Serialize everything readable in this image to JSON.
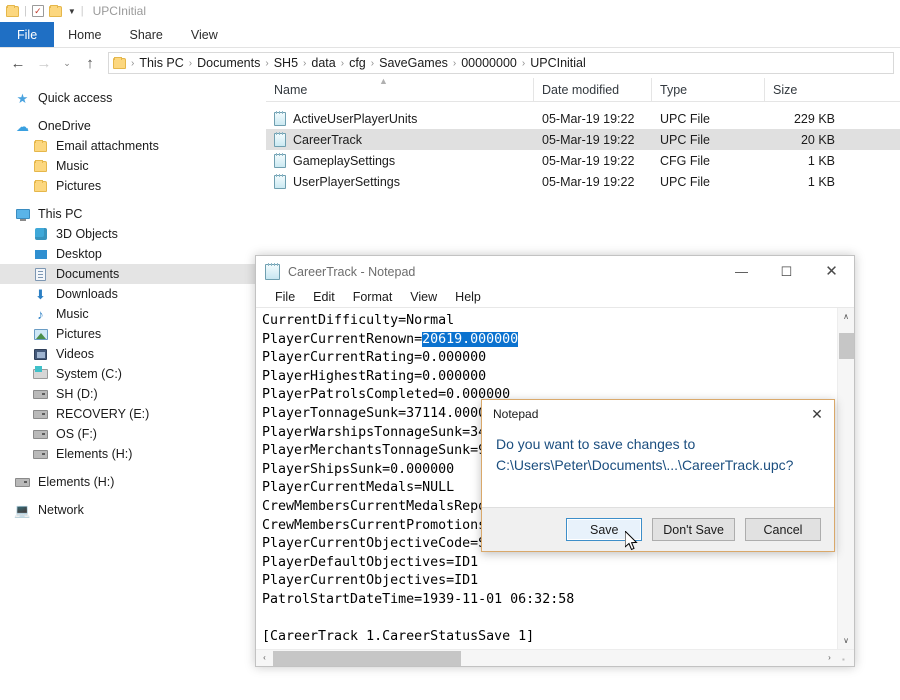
{
  "explorer": {
    "quick_access_toolbar": {
      "title": "UPCInitial",
      "icons": [
        "folder-icon",
        "properties-icon",
        "new-folder-icon",
        "customize-chevron-icon"
      ]
    },
    "ribbon_tabs": [
      {
        "label": "File",
        "active": true
      },
      {
        "label": "Home",
        "active": false
      },
      {
        "label": "Share",
        "active": false
      },
      {
        "label": "View",
        "active": false
      }
    ],
    "nav_buttons": {
      "back": "←",
      "forward": "→",
      "recent": "⌄",
      "up": "↑"
    },
    "breadcrumb": [
      "This PC",
      "Documents",
      "SH5",
      "data",
      "cfg",
      "SaveGames",
      "00000000",
      "UPCInitial"
    ],
    "sidebar": [
      {
        "label": "Quick access",
        "icon": "star-icon",
        "indent": 0,
        "selected": false
      },
      {
        "label": "OneDrive",
        "icon": "cloud-icon",
        "indent": 0,
        "selected": false
      },
      {
        "label": "Email attachments",
        "icon": "folder-icon",
        "indent": 1,
        "selected": false
      },
      {
        "label": "Music",
        "icon": "folder-icon",
        "indent": 1,
        "selected": false
      },
      {
        "label": "Pictures",
        "icon": "folder-icon",
        "indent": 1,
        "selected": false
      },
      {
        "label": "This PC",
        "icon": "this-pc-icon",
        "indent": 0,
        "selected": false
      },
      {
        "label": "3D Objects",
        "icon": "3d-objects-icon",
        "indent": 1,
        "selected": false
      },
      {
        "label": "Desktop",
        "icon": "desktop-icon",
        "indent": 1,
        "selected": false
      },
      {
        "label": "Documents",
        "icon": "documents-icon",
        "indent": 1,
        "selected": true
      },
      {
        "label": "Downloads",
        "icon": "downloads-icon",
        "indent": 1,
        "selected": false
      },
      {
        "label": "Music",
        "icon": "music-icon",
        "indent": 1,
        "selected": false
      },
      {
        "label": "Pictures",
        "icon": "pictures-icon",
        "indent": 1,
        "selected": false
      },
      {
        "label": "Videos",
        "icon": "videos-icon",
        "indent": 1,
        "selected": false
      },
      {
        "label": "System (C:)",
        "icon": "system-drive-icon",
        "indent": 1,
        "selected": false
      },
      {
        "label": "SH  (D:)",
        "icon": "drive-icon",
        "indent": 1,
        "selected": false
      },
      {
        "label": "RECOVERY (E:)",
        "icon": "drive-icon",
        "indent": 1,
        "selected": false
      },
      {
        "label": "OS (F:)",
        "icon": "drive-icon",
        "indent": 1,
        "selected": false
      },
      {
        "label": "Elements (H:)",
        "icon": "drive-icon",
        "indent": 1,
        "selected": false
      },
      {
        "label": "Elements (H:)",
        "icon": "drive-icon",
        "indent": 0,
        "selected": false
      },
      {
        "label": "Network",
        "icon": "network-icon",
        "indent": 0,
        "selected": false
      }
    ],
    "columns": [
      "Name",
      "Date modified",
      "Type",
      "Size"
    ],
    "sort_indicator": "▲",
    "files": [
      {
        "name": "ActiveUserPlayerUnits",
        "date": "05-Mar-19 19:22",
        "type": "UPC File",
        "size": "229 KB",
        "selected": false
      },
      {
        "name": "CareerTrack",
        "date": "05-Mar-19 19:22",
        "type": "UPC File",
        "size": "20 KB",
        "selected": true
      },
      {
        "name": "GameplaySettings",
        "date": "05-Mar-19 19:22",
        "type": "CFG File",
        "size": "1 KB",
        "selected": false
      },
      {
        "name": "UserPlayerSettings",
        "date": "05-Mar-19 19:22",
        "type": "UPC File",
        "size": "1 KB",
        "selected": false
      }
    ]
  },
  "notepad": {
    "title": "CareerTrack - Notepad",
    "window_controls": {
      "minimize": "—",
      "maximize": "☐",
      "close": "✕"
    },
    "menu": [
      "File",
      "Edit",
      "Format",
      "View",
      "Help"
    ],
    "lines_before_selection": "CurrentDifficulty=Normal\nPlayerCurrentRenown=",
    "selected_value": "20619.000000",
    "lines_after_selection": "\nPlayerCurrentRating=0.000000\nPlayerHighestRating=0.000000\nPlayerPatrolsCompleted=0.000000\nPlayerTonnageSunk=37114.0000\nPlayerWarshipsTonnageSunk=34\nPlayerMerchantsTonnageSunk=9\nPlayerShipsSunk=0.000000\nPlayerCurrentMedals=NULL\nCrewMembersCurrentMedalsRepo\nCrewMembersCurrentPromotions\nPlayerCurrentObjectiveCode=S\nPlayerDefaultObjectives=ID1\nPlayerCurrentObjectives=ID1\nPatrolStartDateTime=1939-11-01 06:32:58\n\n[CareerTrack 1.CareerStatusSave 1]",
    "scroll_up_arrow": "∧",
    "scroll_down_arrow": "∨",
    "scroll_left_arrow": "‹",
    "scroll_right_arrow": "›"
  },
  "save_dialog": {
    "title": "Notepad",
    "close_icon": "✕",
    "message_line1": "Do you want to save changes to",
    "message_line2": "C:\\Users\\Peter\\Documents\\...\\CareerTrack.upc?",
    "buttons": [
      {
        "label": "Save",
        "default": true
      },
      {
        "label": "Don't Save",
        "default": false
      },
      {
        "label": "Cancel",
        "default": false
      }
    ]
  },
  "colors": {
    "ribbon_file_tab": "#1f6fc4",
    "selection_highlight": "#0b72cf",
    "dialog_border": "#d9a86a",
    "dialog_text": "#1b4e7f",
    "default_button_border": "#3d8ec9",
    "row_selected": "#e0e0e0"
  }
}
